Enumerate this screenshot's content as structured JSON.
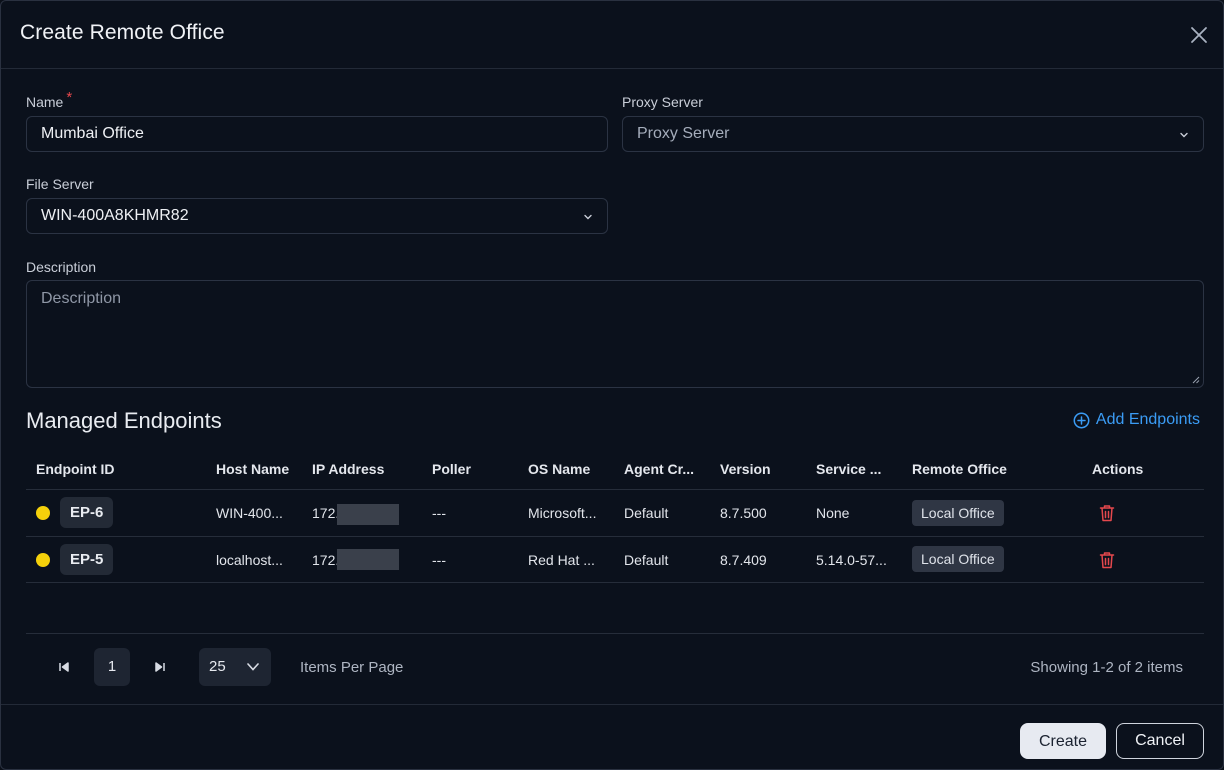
{
  "modal": {
    "title": "Create Remote Office"
  },
  "form": {
    "name_label": "Name",
    "required_mark": "*",
    "name_value": "Mumbai Office",
    "proxy_label": "Proxy Server",
    "proxy_placeholder": "Proxy Server",
    "file_server_label": "File Server",
    "file_server_value": "WIN-400A8KHMR82",
    "description_label": "Description",
    "description_placeholder": "Description"
  },
  "endpoints": {
    "title": "Managed Endpoints",
    "add_label": "Add Endpoints",
    "columns": [
      "Endpoint ID",
      "Host Name",
      "IP Address",
      "Poller",
      "OS Name",
      "Agent Cr...",
      "Version",
      "Service ...",
      "Remote Office",
      "Actions"
    ],
    "rows": [
      {
        "status_color": "#f5d10b",
        "id": "EP-6",
        "host": "WIN-400...",
        "ip": "172.",
        "poller": "---",
        "os": "Microsoft...",
        "agent": "Default",
        "version": "8.7.500",
        "service": "None",
        "office": "Local Office"
      },
      {
        "status_color": "#f5d10b",
        "id": "EP-5",
        "host": "localhost...",
        "ip": "172.",
        "poller": "---",
        "os": "Red Hat ...",
        "agent": "Default",
        "version": "8.7.409",
        "service": "5.14.0-57...",
        "office": "Local Office"
      }
    ]
  },
  "pagination": {
    "current_page": "1",
    "per_page": "25",
    "per_page_label": "Items Per Page",
    "summary": "Showing 1-2 of 2 items"
  },
  "footer": {
    "create_label": "Create",
    "cancel_label": "Cancel"
  },
  "colors": {
    "accent": "#3b9cf5",
    "danger": "#e5484d",
    "status_warning": "#f5d10b"
  }
}
